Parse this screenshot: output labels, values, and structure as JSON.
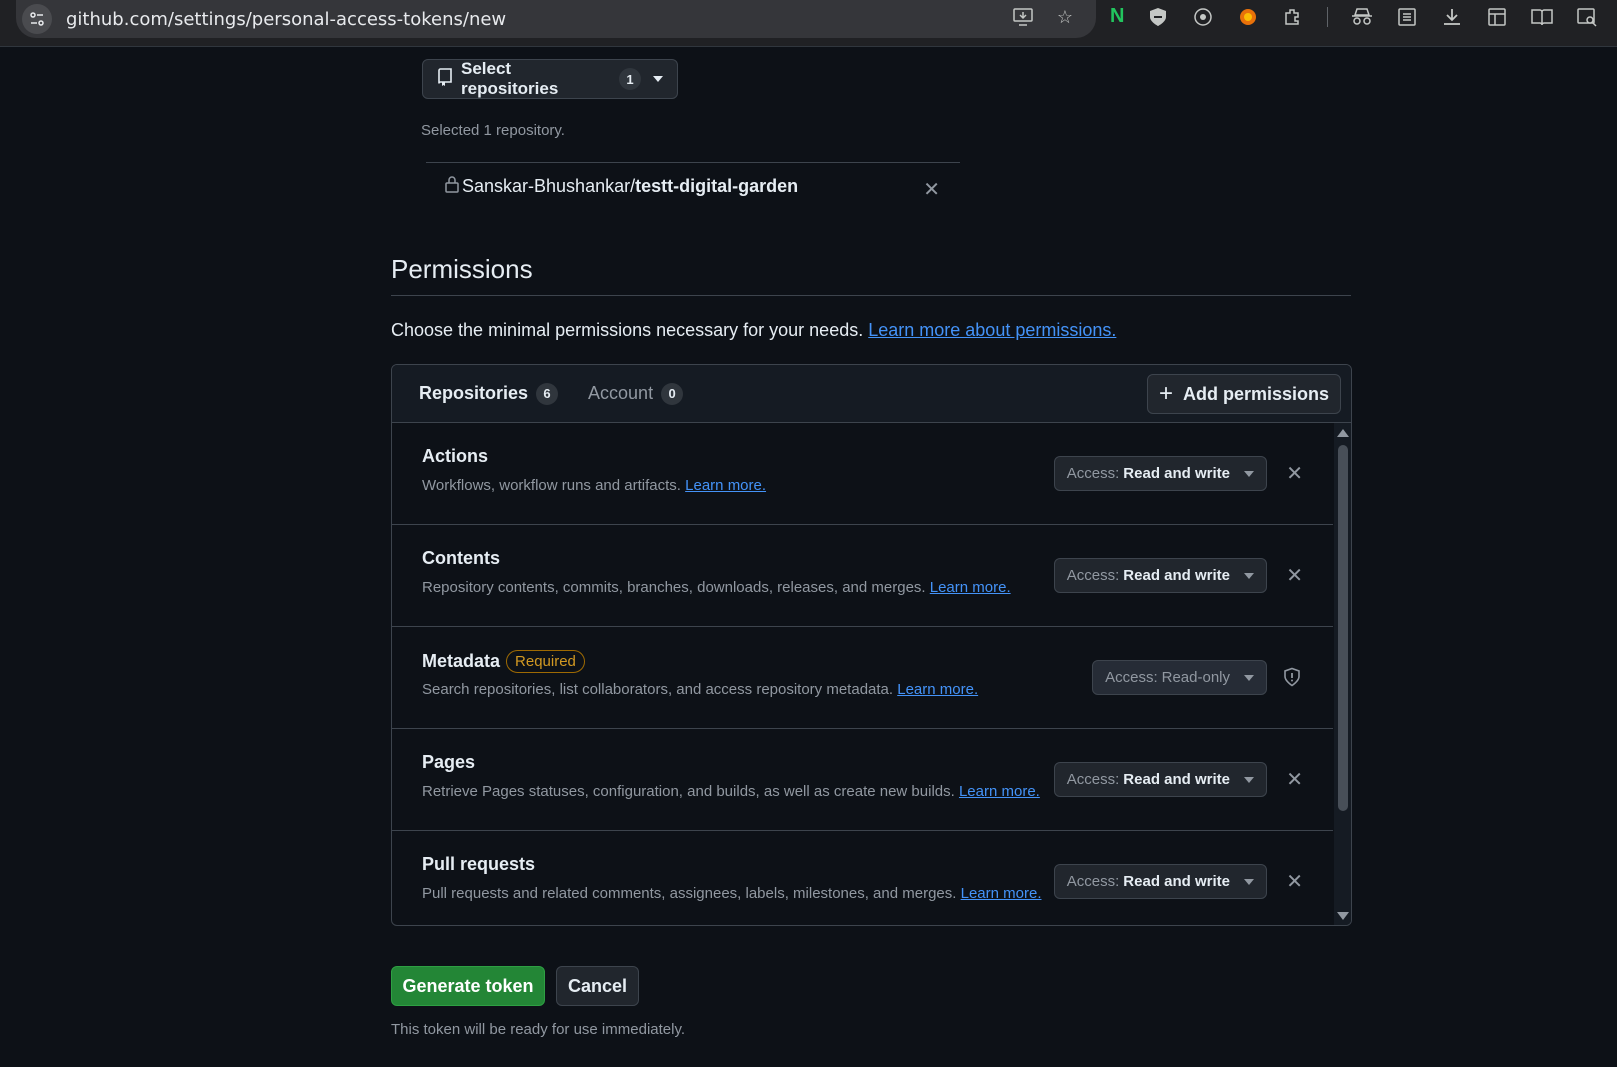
{
  "browser": {
    "url": "github.com/settings/personal-access-tokens/new"
  },
  "repo_select": {
    "label": "Select repositories",
    "count": "1",
    "selected_note": "Selected 1 repository.",
    "repo_owner": "Sanskar-Bhushankar/",
    "repo_name": "testt-digital-garden"
  },
  "permissions": {
    "title": "Permissions",
    "description": "Choose the minimal permissions necessary for your needs.",
    "learn_link": "Learn more about permissions.",
    "tabs": [
      {
        "label": "Repositories",
        "count": "6"
      },
      {
        "label": "Account",
        "count": "0"
      }
    ],
    "add_label": "Add permissions",
    "items": [
      {
        "title": "Actions",
        "desc": "Workflows, workflow runs and artifacts.",
        "link": "Learn more.",
        "access_prefix": "Access:",
        "access_value": "Read and write"
      },
      {
        "title": "Contents",
        "desc": "Repository contents, commits, branches, downloads, releases, and merges.",
        "link": "Learn more.",
        "access_prefix": "Access:",
        "access_value": "Read and write"
      },
      {
        "title": "Metadata",
        "badge": "Required",
        "desc": "Search repositories, list collaborators, and access repository metadata.",
        "link": "Learn more.",
        "access_prefix": "Access:",
        "access_value": "Read-only"
      },
      {
        "title": "Pages",
        "desc": "Retrieve Pages statuses, configuration, and builds, as well as create new builds.",
        "link": "Learn more.",
        "access_prefix": "Access:",
        "access_value": "Read and write"
      },
      {
        "title": "Pull requests",
        "desc": "Pull requests and related comments, assignees, labels, milestones, and merges.",
        "link": "Learn more.",
        "access_prefix": "Access:",
        "access_value": "Read and write"
      }
    ]
  },
  "actions": {
    "generate_label": "Generate token",
    "cancel_label": "Cancel",
    "ready_note": "This token will be ready for use immediately."
  }
}
